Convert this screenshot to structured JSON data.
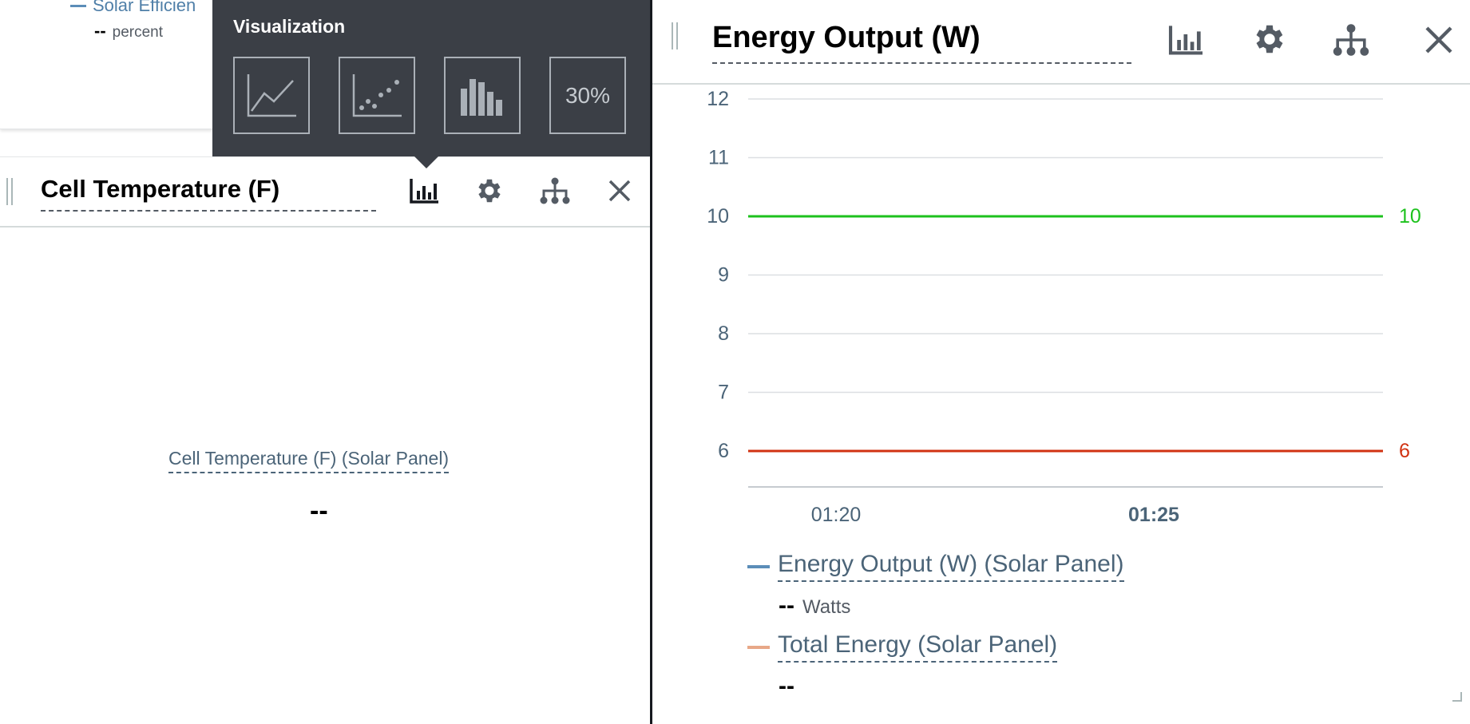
{
  "top_widget": {
    "legend_label": "Solar Efficien",
    "legend_color": "#5b8db8",
    "value": "--",
    "unit": "percent"
  },
  "visualization_popover": {
    "title": "Visualization",
    "options": [
      {
        "name": "line-chart",
        "label": ""
      },
      {
        "name": "scatter-chart",
        "label": ""
      },
      {
        "name": "bar-chart",
        "label": ""
      },
      {
        "name": "kpi",
        "label": "30%"
      }
    ]
  },
  "left_panel": {
    "title": "Cell Temperature (F)",
    "kpi_label": "Cell Temperature (F) (Solar Panel)",
    "kpi_value": "--",
    "icons": [
      "bar-chart-icon",
      "gear-icon",
      "hierarchy-icon",
      "close-icon"
    ]
  },
  "right_panel": {
    "title": "Energy Output (W)",
    "icons": [
      "bar-chart-icon",
      "gear-icon",
      "hierarchy-icon",
      "close-icon"
    ],
    "legend": [
      {
        "label": "Energy Output (W) (Solar Panel)",
        "value": "--",
        "unit": "Watts",
        "color": "#5b8db8"
      },
      {
        "label": "Total Energy (Solar Panel)",
        "value": "--",
        "unit": "",
        "color": "#e8a888"
      }
    ]
  },
  "chart_data": {
    "type": "line",
    "yticks": [
      6,
      7,
      8,
      9,
      10,
      11,
      12
    ],
    "ylim": [
      6,
      12
    ],
    "xticks": [
      {
        "label": "01:20",
        "bold": false
      },
      {
        "label": "01:25",
        "bold": true
      }
    ],
    "thresholds": [
      {
        "value": 10,
        "label": "10",
        "color": "#1dc21d"
      },
      {
        "value": 6,
        "label": "6",
        "color": "#d13212"
      }
    ],
    "grid": true
  }
}
